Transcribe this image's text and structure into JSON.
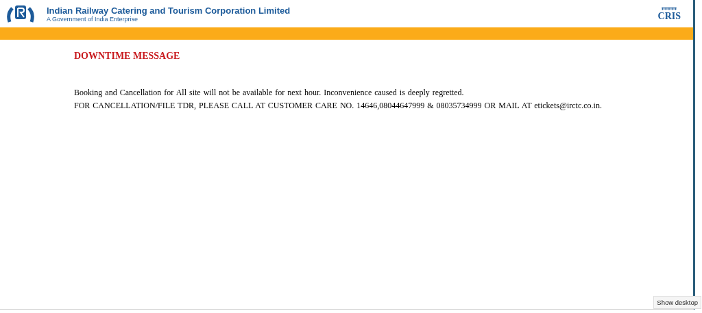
{
  "header": {
    "org_name": "Indian Railway Catering and Tourism Corporation Limited",
    "tagline": "A Government of India Enterprise",
    "partner_logo": "CRIS"
  },
  "message": {
    "title": "DOWNTIME MESSAGE",
    "lines": [
      "Booking and Cancellation for All site will not be available for next hour. Inconvenience caused is deeply regretted.",
      "FOR CANCELLATION/FILE TDR, PLEASE CALL AT CUSTOMER CARE NO. 14646,08044647999 & 08035734999 OR MAIL AT etickets@irctc.co.in."
    ]
  },
  "tooltip": "Show desktop"
}
